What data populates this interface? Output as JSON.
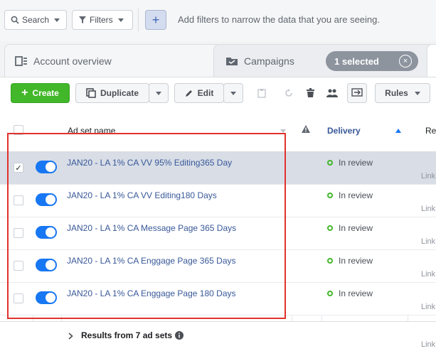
{
  "filterbar": {
    "search_label": "Search",
    "filters_label": "Filters",
    "add_label": "+",
    "hint": "Add filters to narrow the data that you are seeing."
  },
  "tabs": {
    "account_label": "Account overview",
    "campaigns_label": "Campaigns",
    "selected_label": "1 selected",
    "clear_glyph": "×"
  },
  "toolbar": {
    "create_label": "Create",
    "duplicate_label": "Duplicate",
    "edit_label": "Edit",
    "rules_label": "Rules"
  },
  "table": {
    "headers": {
      "name": "Ad set name",
      "delivery": "Delivery",
      "results_partial": "Re"
    },
    "rows": [
      {
        "name": "JAN20 - LA 1% CA VV 95% Editing365 Day",
        "delivery": "In review",
        "link": "Link",
        "selected": true
      },
      {
        "name": "JAN20 - LA 1% CA VV Editing180 Days",
        "delivery": "In review",
        "link": "Link",
        "selected": false
      },
      {
        "name": "JAN20 - LA 1% CA Message Page 365 Days",
        "delivery": "In review",
        "link": "Link",
        "selected": false
      },
      {
        "name": "JAN20 - LA 1% CA Enggage Page 365 Days",
        "delivery": "In review",
        "link": "Link",
        "selected": false
      },
      {
        "name": "JAN20 - LA 1% CA Enggage Page 180 Days",
        "delivery": "In review",
        "link": "Link",
        "selected": false
      }
    ],
    "footer_label": "Results from 7 ad sets",
    "footer_link": "Link"
  },
  "colors": {
    "accent": "#1877f2",
    "create": "#42b72a",
    "highlight": "#e0322d"
  }
}
